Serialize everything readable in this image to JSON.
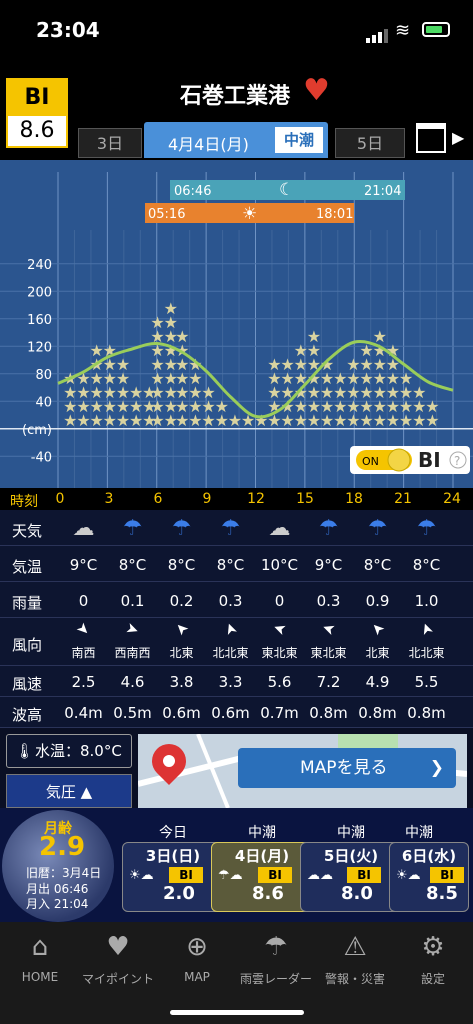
{
  "status": {
    "time": "23:04"
  },
  "header": {
    "bi_label": "BI",
    "bi_value": "8.6",
    "place": "石巻工業港",
    "prev_day": "3日",
    "current_date": "4月4日(月)",
    "tide_type": "中潮",
    "next_day": "5日"
  },
  "chart": {
    "moon_rise": "06:46",
    "moon_set": "21:04",
    "sun_rise": "05:16",
    "sun_set": "18:01",
    "y_ticks": [
      "240",
      "200",
      "160",
      "120",
      "80",
      "40",
      "(cm)",
      "-40"
    ],
    "bi_toggle_on": "ON",
    "bi_toggle_label": "BI",
    "help": "?"
  },
  "chart_data": {
    "type": "line",
    "x": [
      0,
      1.5,
      3,
      4.5,
      6,
      7.5,
      9,
      10.5,
      12,
      13.5,
      15,
      16.5,
      18,
      19.5,
      21,
      22.5,
      24
    ],
    "series": [
      {
        "values": [
          66,
          82,
          104,
          116,
          124,
          112,
          84,
          46,
          18,
          28,
          64,
          102,
          126,
          120,
          94,
          68,
          56
        ]
      }
    ],
    "ylim": [
      -60,
      260
    ],
    "grid": true,
    "star_columns": [
      [
        0.8,
        4
      ],
      [
        1.6,
        4
      ],
      [
        2.4,
        6
      ],
      [
        3.2,
        6
      ],
      [
        4.0,
        5
      ],
      [
        4.8,
        3
      ],
      [
        5.6,
        3
      ],
      [
        6.1,
        8
      ],
      [
        6.9,
        9
      ],
      [
        7.6,
        7
      ],
      [
        8.4,
        5
      ],
      [
        9.2,
        3
      ],
      [
        10.0,
        2
      ],
      [
        10.8,
        1
      ],
      [
        11.6,
        1
      ],
      [
        12.4,
        1
      ],
      [
        13.2,
        5
      ],
      [
        14.0,
        5
      ],
      [
        14.8,
        6
      ],
      [
        15.6,
        7
      ],
      [
        16.4,
        5
      ],
      [
        17.2,
        4
      ],
      [
        18.0,
        5
      ],
      [
        18.8,
        6
      ],
      [
        19.6,
        7
      ],
      [
        20.4,
        6
      ],
      [
        21.2,
        4
      ],
      [
        22.0,
        3
      ],
      [
        22.8,
        2
      ]
    ]
  },
  "time_row": {
    "label": "時刻",
    "ticks": [
      "0",
      "3",
      "6",
      "9",
      "12",
      "15",
      "18",
      "21",
      "24"
    ]
  },
  "table": {
    "weather_label": "天気",
    "weather_icons": [
      "cloud-icon",
      "umbrella-icon",
      "umbrella-icon",
      "umbrella-icon",
      "cloud-icon",
      "umbrella-icon",
      "umbrella-icon",
      "umbrella-icon"
    ],
    "temp_label": "気温",
    "temps": [
      "9°C",
      "8°C",
      "8°C",
      "8°C",
      "10°C",
      "9°C",
      "8°C",
      "8°C"
    ],
    "rain_label": "雨量",
    "rain": [
      "0",
      "0.1",
      "0.2",
      "0.3",
      "0",
      "0.3",
      "0.9",
      "1.0"
    ],
    "wind_dir_label": "風向",
    "wind_dirs": [
      "南西",
      "西南西",
      "北東",
      "北北東",
      "東北東",
      "東北東",
      "北東",
      "北北東"
    ],
    "wind_speed_label": "風速",
    "wind_speeds": [
      "2.5",
      "4.6",
      "3.8",
      "3.3",
      "5.6",
      "7.2",
      "4.9",
      "5.5"
    ],
    "wave_label": "波高",
    "waves": [
      "0.4m",
      "0.5m",
      "0.6m",
      "0.6m",
      "0.7m",
      "0.8m",
      "0.8m",
      "0.8m"
    ]
  },
  "bottom": {
    "water_temp": "水温：8.0°C",
    "pressure": "気圧 ▲",
    "map_button": "MAPを見る"
  },
  "moon": {
    "label": "月齢",
    "age": "2.9",
    "lunar_date": "旧暦：3月4日",
    "moonrise": "月出 06:46",
    "moonset": "月入 21:04"
  },
  "day_cards": [
    {
      "header": "今日",
      "date": "3日(日)",
      "bi": "BI",
      "bi_value": "2.0"
    },
    {
      "header": "中潮",
      "date": "4日(月)",
      "bi": "BI",
      "bi_value": "8.6"
    },
    {
      "header": "中潮",
      "date": "5日(火)",
      "bi": "BI",
      "bi_value": "8.0"
    },
    {
      "header": "中潮",
      "date": "6日(水)",
      "bi": "BI",
      "bi_value": "8.5"
    }
  ],
  "nav": {
    "home": "HOME",
    "mypoint": "マイポイント",
    "map": "MAP",
    "rain_radar": "雨雲レーダー",
    "alerts": "警報・災害",
    "settings": "設定"
  },
  "colors": {
    "accent": "#f5c400",
    "tab": "#4a90d9",
    "chart_bg": "#2b558f",
    "curve": "#9acd5a"
  }
}
